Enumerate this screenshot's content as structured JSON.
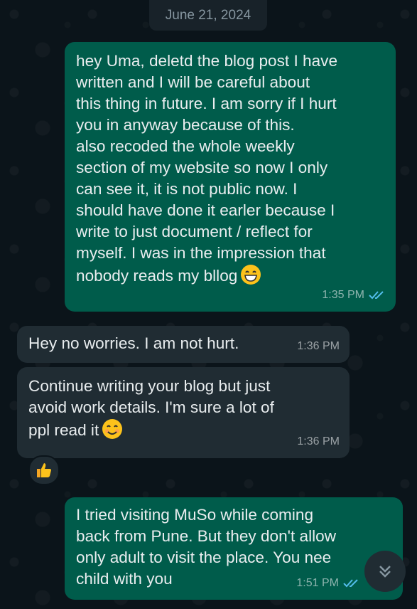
{
  "date_chip": "June 21, 2024",
  "messages": [
    {
      "text": "hey Uma, deletd the blog post I have\nwritten and I will be careful about\nthis thing in future. I am sorry if I hurt\nyou in anyway because of this.\nalso recoded the whole weekly\nsection of my website so now I only\ncan see it, it is not public now. I\nshould have done it earler because I\nwrite to just document / reflect for\nmyself. I was in the impression that\nnobody reads my bllog",
      "time": "1:35 PM",
      "direction": "outgoing",
      "emoji": "grinning-face-emoji",
      "status": "read"
    },
    {
      "text": "Hey no worries. I am not hurt.",
      "time": "1:36 PM",
      "direction": "incoming"
    },
    {
      "text": "Continue writing your blog but just\navoid work details. I'm sure a lot of\nppl read it",
      "time": "1:36 PM",
      "direction": "incoming",
      "emoji": "smiling-face-emoji",
      "reaction": "thumbs-up-emoji"
    },
    {
      "text": "I tried visiting MuSo while coming\nback from Pune. But they don't allow\nonly adult to visit the place. You nee\nchild with you",
      "time": "1:51 PM",
      "direction": "outgoing",
      "status": "read"
    }
  ],
  "colors": {
    "background": "#0b141a",
    "outgoing_bubble": "#005c4b",
    "incoming_bubble": "#202c33",
    "read_ticks": "#53bdeb",
    "text": "#e9edef"
  },
  "icons": {
    "scroll_down": "double-chevron-down-icon"
  }
}
